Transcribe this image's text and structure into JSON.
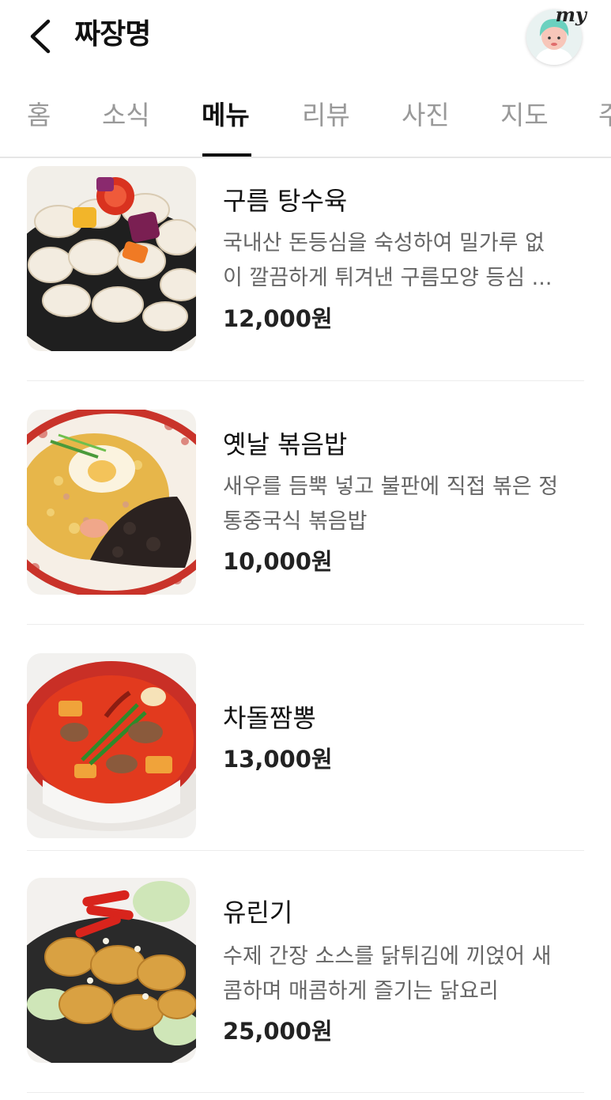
{
  "header": {
    "title": "짜장명",
    "my_label": "my"
  },
  "tabs": [
    {
      "label": "홈",
      "active": false
    },
    {
      "label": "소식",
      "active": false
    },
    {
      "label": "메뉴",
      "active": true
    },
    {
      "label": "리뷰",
      "active": false
    },
    {
      "label": "사진",
      "active": false
    },
    {
      "label": "지도",
      "active": false
    },
    {
      "label": "주",
      "active": false
    }
  ],
  "menu": [
    {
      "name": "구름 탕수육",
      "desc_lines": [
        "국내산 돈등심을 숙성하여 밀가루 없",
        "이 깔끔하게 튀겨낸 구름모양 등심 ..."
      ],
      "price": "12,000원"
    },
    {
      "name": "옛날 볶음밥",
      "desc_lines": [
        "새우를 듬뿍 넣고 불판에 직접 볶은 정",
        "통중국식 볶음밥"
      ],
      "price": "10,000원"
    },
    {
      "name": "차돌짬뽕",
      "desc_lines": [],
      "price": "13,000원"
    },
    {
      "name": "유린기",
      "desc_lines": [
        "수제 간장 소스를 닭튀김에 끼얹어 새",
        "콤하며 매콤하게 즐기는 닭요리"
      ],
      "price": "25,000원"
    }
  ],
  "colors": {
    "text_primary": "#111111",
    "text_secondary": "#666666",
    "tab_inactive": "#999999",
    "divider": "#ececec"
  }
}
